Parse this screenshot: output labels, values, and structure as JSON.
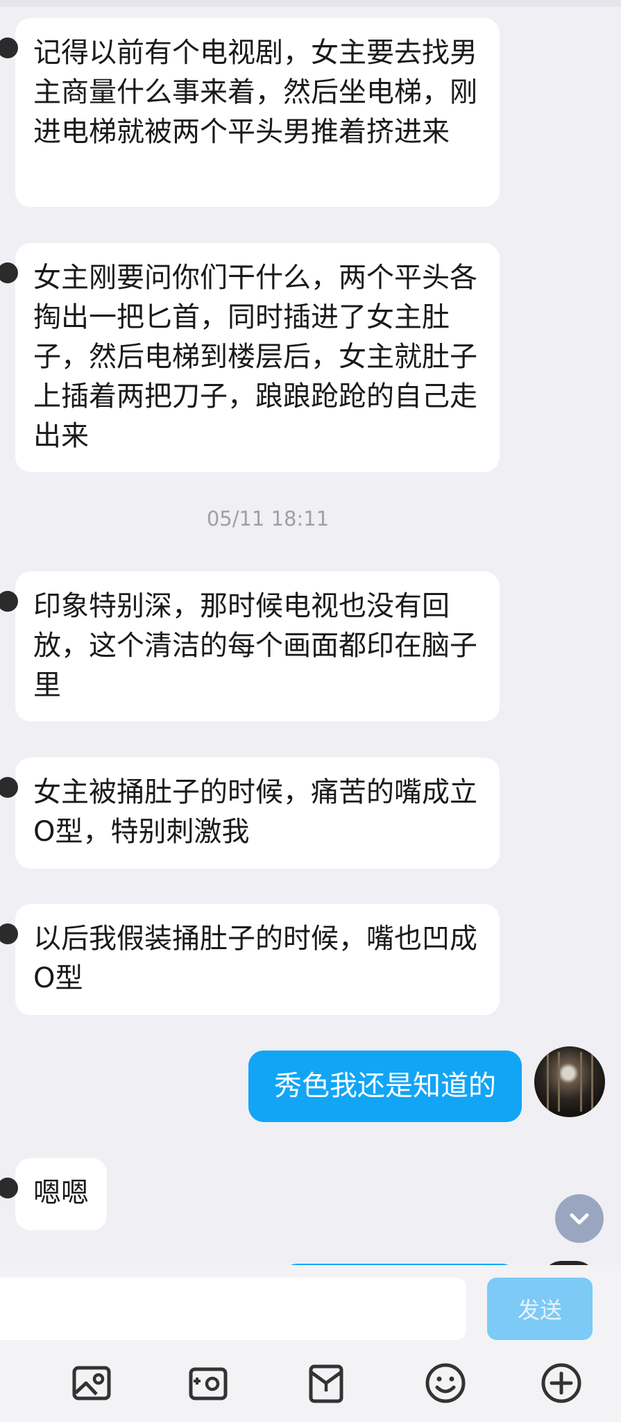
{
  "messages": [
    {
      "text": "记得以前有个电视剧，女主要去找男主商量什么事来着，然后坐电梯，刚进电梯就被两个平头男推着挤进来"
    },
    {
      "text": "女主刚要问你们干什么，两个平头各掏出一把匕首，同时插进了女主肚子，然后电梯到楼层后，女主就肚子上插着两把刀子，踉踉跄跄的自己走出来"
    },
    {
      "text": "印象特别深，那时候电视也没有回放，这个清洁的每个画面都印在脑子里"
    },
    {
      "text": "女主被捅肚子的时候，痛苦的嘴成立O型，特别刺激我"
    },
    {
      "text": "以后我假装捅肚子的时候，嘴也凹成O型"
    },
    {
      "text": "嗯嗯"
    }
  ],
  "timestamp": "05/11 18:11",
  "outgoing": {
    "text": "秀色我还是知道的"
  },
  "composer": {
    "input_value": "",
    "send_label": "发送"
  },
  "toolbar_icons": [
    "image-icon",
    "camera-icon",
    "red-packet-icon",
    "emoji-icon",
    "plus-icon"
  ],
  "colors": {
    "background": "#efeff4",
    "incoming_bubble": "#ffffff",
    "outgoing_bubble": "#12a5f5",
    "send_button_disabled": "#7ccaf5",
    "timestamp_text": "#9ea0a6",
    "icon": "#333333"
  }
}
